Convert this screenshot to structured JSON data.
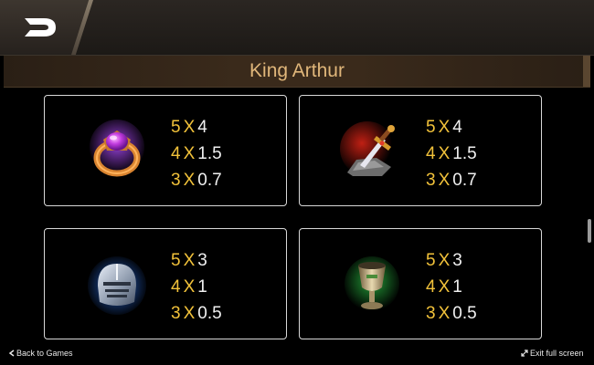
{
  "header": {
    "title": "King Arthur"
  },
  "paytable": [
    {
      "symbol_icon": "magic-ring-icon",
      "rows": [
        {
          "count": "5",
          "x": "X",
          "value": "4"
        },
        {
          "count": "4",
          "x": "X",
          "value": "1.5"
        },
        {
          "count": "3",
          "x": "X",
          "value": "0.7"
        }
      ]
    },
    {
      "symbol_icon": "sword-in-stone-icon",
      "rows": [
        {
          "count": "5",
          "x": "X",
          "value": "4"
        },
        {
          "count": "4",
          "x": "X",
          "value": "1.5"
        },
        {
          "count": "3",
          "x": "X",
          "value": "0.7"
        }
      ]
    },
    {
      "symbol_icon": "knight-helmet-icon",
      "rows": [
        {
          "count": "5",
          "x": "X",
          "value": "3"
        },
        {
          "count": "4",
          "x": "X",
          "value": "1"
        },
        {
          "count": "3",
          "x": "X",
          "value": "0.5"
        }
      ]
    },
    {
      "symbol_icon": "holy-grail-icon",
      "rows": [
        {
          "count": "5",
          "x": "X",
          "value": "3"
        },
        {
          "count": "4",
          "x": "X",
          "value": "1"
        },
        {
          "count": "3",
          "x": "X",
          "value": "0.5"
        }
      ]
    }
  ],
  "footer": {
    "back_label": "Back to Games",
    "exit_label": "Exit full screen"
  },
  "colors": {
    "title": "#e0b67a",
    "multiplier_accent": "#f2c23a",
    "card_border": "#d8d8d8"
  }
}
